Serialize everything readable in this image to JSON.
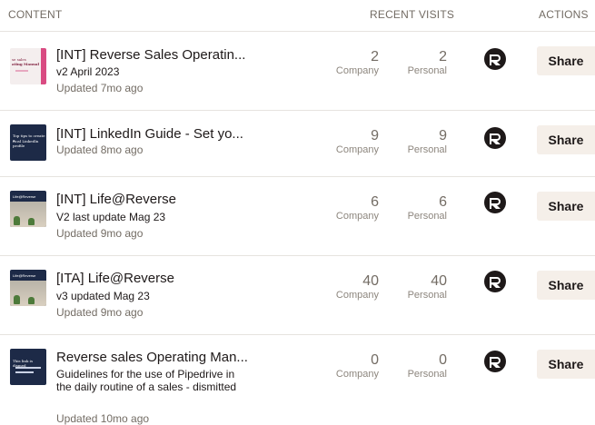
{
  "header": {
    "content": "CONTENT",
    "recent_visits": "RECENT VISITS",
    "actions": "ACTIONS"
  },
  "labels": {
    "company": "Company",
    "personal": "Personal",
    "share": "Share"
  },
  "rows": [
    {
      "title": "[INT] Reverse Sales Operatin...",
      "description": "v2 April 2023",
      "updated": "Updated 7mo ago",
      "company": "2",
      "personal": "2",
      "thumb_text": [
        "se sales",
        "ating Manual"
      ]
    },
    {
      "title": "[INT] LinkedIn Guide - Set yo...",
      "description": "",
      "updated": "Updated 8mo ago",
      "company": "9",
      "personal": "9",
      "thumb_text": [
        "Top tips to create a",
        "rical LinkedIn profile"
      ]
    },
    {
      "title": "[INT] Life@Reverse",
      "description": "V2 last update Mag 23",
      "updated": "Updated 9mo ago",
      "company": "6",
      "personal": "6",
      "thumb_text": [
        "Life@Reverse"
      ]
    },
    {
      "title": "[ITA] Life@Reverse",
      "description": "v3 updated Mag 23",
      "updated": "Updated 9mo ago",
      "company": "40",
      "personal": "40",
      "thumb_text": [
        "Life@Reverse"
      ]
    },
    {
      "title": "Reverse sales Operating Man...",
      "description": "Guidelines for the use of Pipedrive in the daily routine of a sales - dismitted",
      "updated": "Updated 10mo ago",
      "company": "0",
      "personal": "0",
      "thumb_text": [
        "This link is dismed"
      ]
    }
  ]
}
